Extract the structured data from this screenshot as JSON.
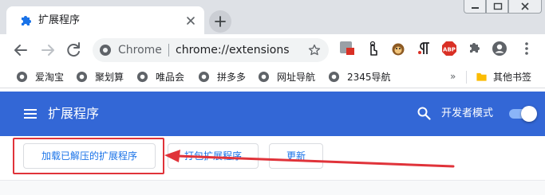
{
  "tab": {
    "title": "扩展程序"
  },
  "toolbar": {
    "omnibox_label": "Chrome",
    "omnibox_url": "chrome://extensions",
    "extension_badge": "ABP"
  },
  "bookmarks": {
    "items": [
      {
        "label": "爱淘宝"
      },
      {
        "label": "聚划算"
      },
      {
        "label": "唯品会"
      },
      {
        "label": "拼多多"
      },
      {
        "label": "网址导航"
      },
      {
        "label": "2345导航"
      }
    ],
    "overflow": "»",
    "other_folder": "其他书签"
  },
  "header": {
    "title": "扩展程序",
    "developer_mode_label": "开发者模式",
    "developer_mode_on": true
  },
  "actions": {
    "load_unpacked": "加载已解压的扩展程序",
    "pack_extension": "打包扩展程序",
    "update": "更新"
  },
  "colors": {
    "header_blue": "#3367d6",
    "link_blue": "#1a73e8",
    "annotation_red": "#e0333a",
    "tabstrip_gray": "#dee1e6"
  }
}
